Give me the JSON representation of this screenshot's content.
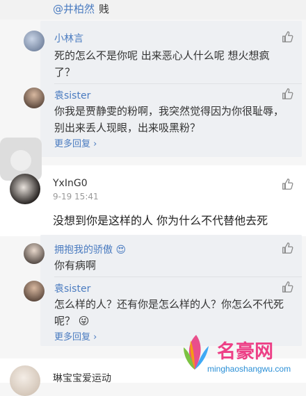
{
  "top": {
    "mention": "@井柏然",
    "mention_tail": " 贱"
  },
  "thread1": {
    "replies": [
      {
        "name": "小林言",
        "text_line1": "死的怎么不是你呢 出来恶心人什么呢 想火想疯",
        "text_line2": "了？"
      },
      {
        "name": "袁sister",
        "text_line1": "你我是贾静雯的粉啊，我突然觉得因为你很耻辱，",
        "text_line2": "别出来丢人现眼，出来吸黑粉？"
      }
    ],
    "more_label": "更多回复"
  },
  "comment2": {
    "user": "YxInG0",
    "time": "9-19 15:41",
    "text": "没想到你是这样的人 你为什么不代替他去死",
    "replies": [
      {
        "name": "拥抱我的骄傲",
        "emoji": "😍",
        "text_line1": "你有病啊",
        "text_line2": ""
      },
      {
        "name": "袁sister",
        "text_line1": "怎么样的人？还有你是怎么样的人？你怎么不代死",
        "text_line2": "呢？",
        "emoji": "😜"
      }
    ],
    "more_label": "更多回复"
  },
  "comment3": {
    "user": "琳宝宝爱运动"
  },
  "watermark": {
    "brand": "名豪网",
    "url": "minghaoshangwu.com"
  },
  "colors": {
    "link": "#4a7bc0",
    "reply_bg": "#eef0f3",
    "page_bg": "#f6f6f6"
  },
  "icons": [
    "thumbs-up-icon",
    "chevron-right-icon",
    "avatar-placeholder"
  ]
}
